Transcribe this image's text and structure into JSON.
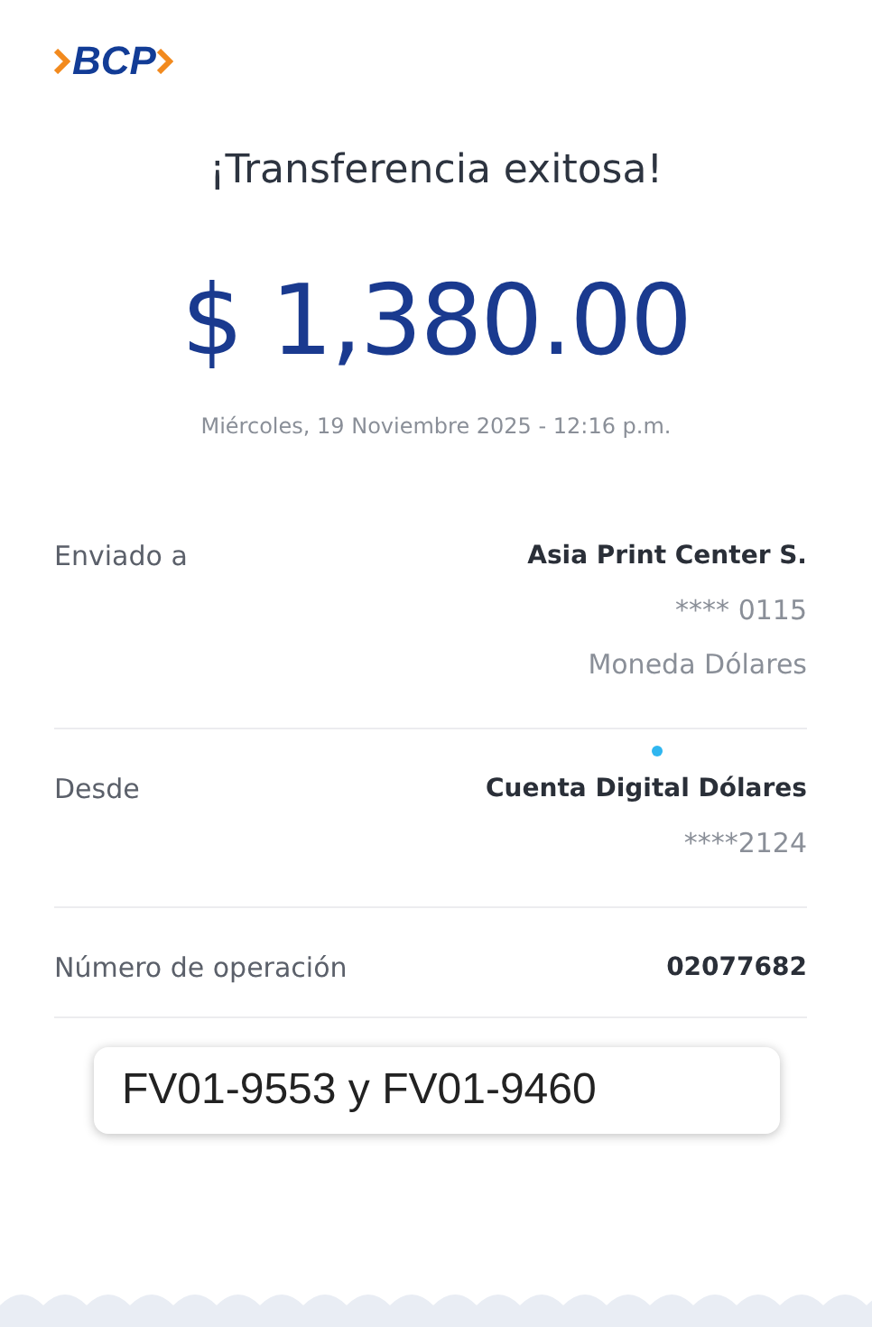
{
  "logo": {
    "text": "BCP"
  },
  "title": "¡Transferencia exitosa!",
  "amount": "$ 1,380.00",
  "datetime": "Miércoles, 19 Noviembre 2025 - 12:16 p.m.",
  "details": [
    {
      "label": "Enviado a",
      "values": [
        "Asia Print Center S.",
        "**** 0115",
        "Moneda Dólares"
      ]
    },
    {
      "label": "Desde",
      "values": [
        "Cuenta Digital Dólares",
        "****2124"
      ]
    },
    {
      "label": "Número de operación",
      "values": [
        "02077682"
      ]
    }
  ],
  "note": "FV01-9553 y FV01-9460"
}
